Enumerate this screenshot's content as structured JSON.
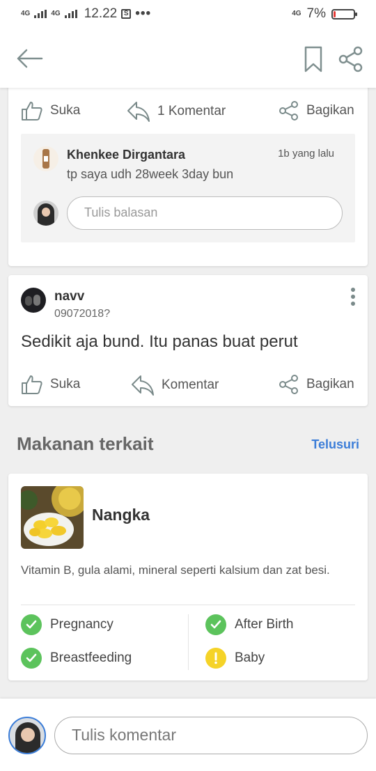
{
  "status_bar": {
    "signal_1": "4G",
    "signal_2": "4G",
    "time": "12.22",
    "right_network": "4G",
    "battery": "7%",
    "battery_level": 0.07,
    "colors": {
      "battery_low": "#e53935"
    }
  },
  "app_bar": {
    "icons": [
      "arrow-left-icon",
      "bookmark-icon",
      "share-icon"
    ]
  },
  "comment_card": {
    "actions": {
      "like": "Suka",
      "comment": "1 Komentar",
      "share": "Bagikan"
    },
    "reply": {
      "name": "Khenkee Dirgantara",
      "time": "1b yang lalu",
      "text": "tp saya udh 28week 3day bun",
      "input_placeholder": "Tulis balasan"
    }
  },
  "post_card": {
    "author": "navv",
    "date": "09072018?",
    "text": "Sedikit aja bund. Itu panas buat perut",
    "actions": {
      "like": "Suka",
      "comment": "Komentar",
      "share": "Bagikan"
    }
  },
  "related": {
    "title": "Makanan terkait",
    "link": "Telusuri",
    "colors": {
      "link": "#3b7dd8"
    }
  },
  "food_card": {
    "name": "Nangka",
    "description": "Vitamin B, gula alami, mineral seperti kalsium dan zat besi.",
    "tags": [
      {
        "label": "Pregnancy",
        "status": "safe",
        "icon": "check-icon"
      },
      {
        "label": "After Birth",
        "status": "safe",
        "icon": "check-icon"
      },
      {
        "label": "Breastfeeding",
        "status": "safe",
        "icon": "check-icon"
      },
      {
        "label": "Baby",
        "status": "caution",
        "icon": "exclamation-icon"
      }
    ],
    "colors": {
      "safe": "#5cc35c",
      "caution": "#f5d328"
    }
  },
  "bottom_bar": {
    "input_placeholder": "Tulis komentar"
  }
}
